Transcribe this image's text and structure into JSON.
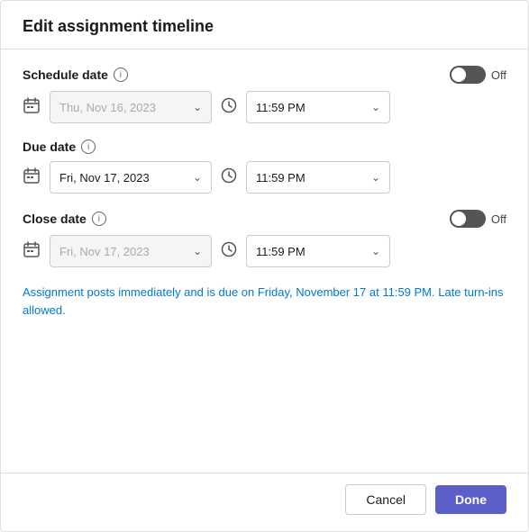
{
  "dialog": {
    "title": "Edit assignment timeline"
  },
  "schedule_date": {
    "label": "Schedule date",
    "toggle_label": "Off",
    "toggle_enabled": false,
    "date_placeholder": "Thu, Nov 16, 2023",
    "time_value": "11:59 PM",
    "disabled": true
  },
  "due_date": {
    "label": "Due date",
    "date_value": "Fri, Nov 17, 2023",
    "time_value": "11:59 PM"
  },
  "close_date": {
    "label": "Close date",
    "toggle_label": "Off",
    "toggle_enabled": false,
    "date_placeholder": "Fri, Nov 17, 2023",
    "time_value": "11:59 PM",
    "disabled": true
  },
  "info_text": "Assignment posts immediately and is due on Friday, November 17 at 11:59 PM. Late turn-ins allowed.",
  "footer": {
    "cancel_label": "Cancel",
    "done_label": "Done"
  },
  "icons": {
    "info": "i",
    "calendar": "📅",
    "chevron": "⌄",
    "clock": "🕐"
  }
}
